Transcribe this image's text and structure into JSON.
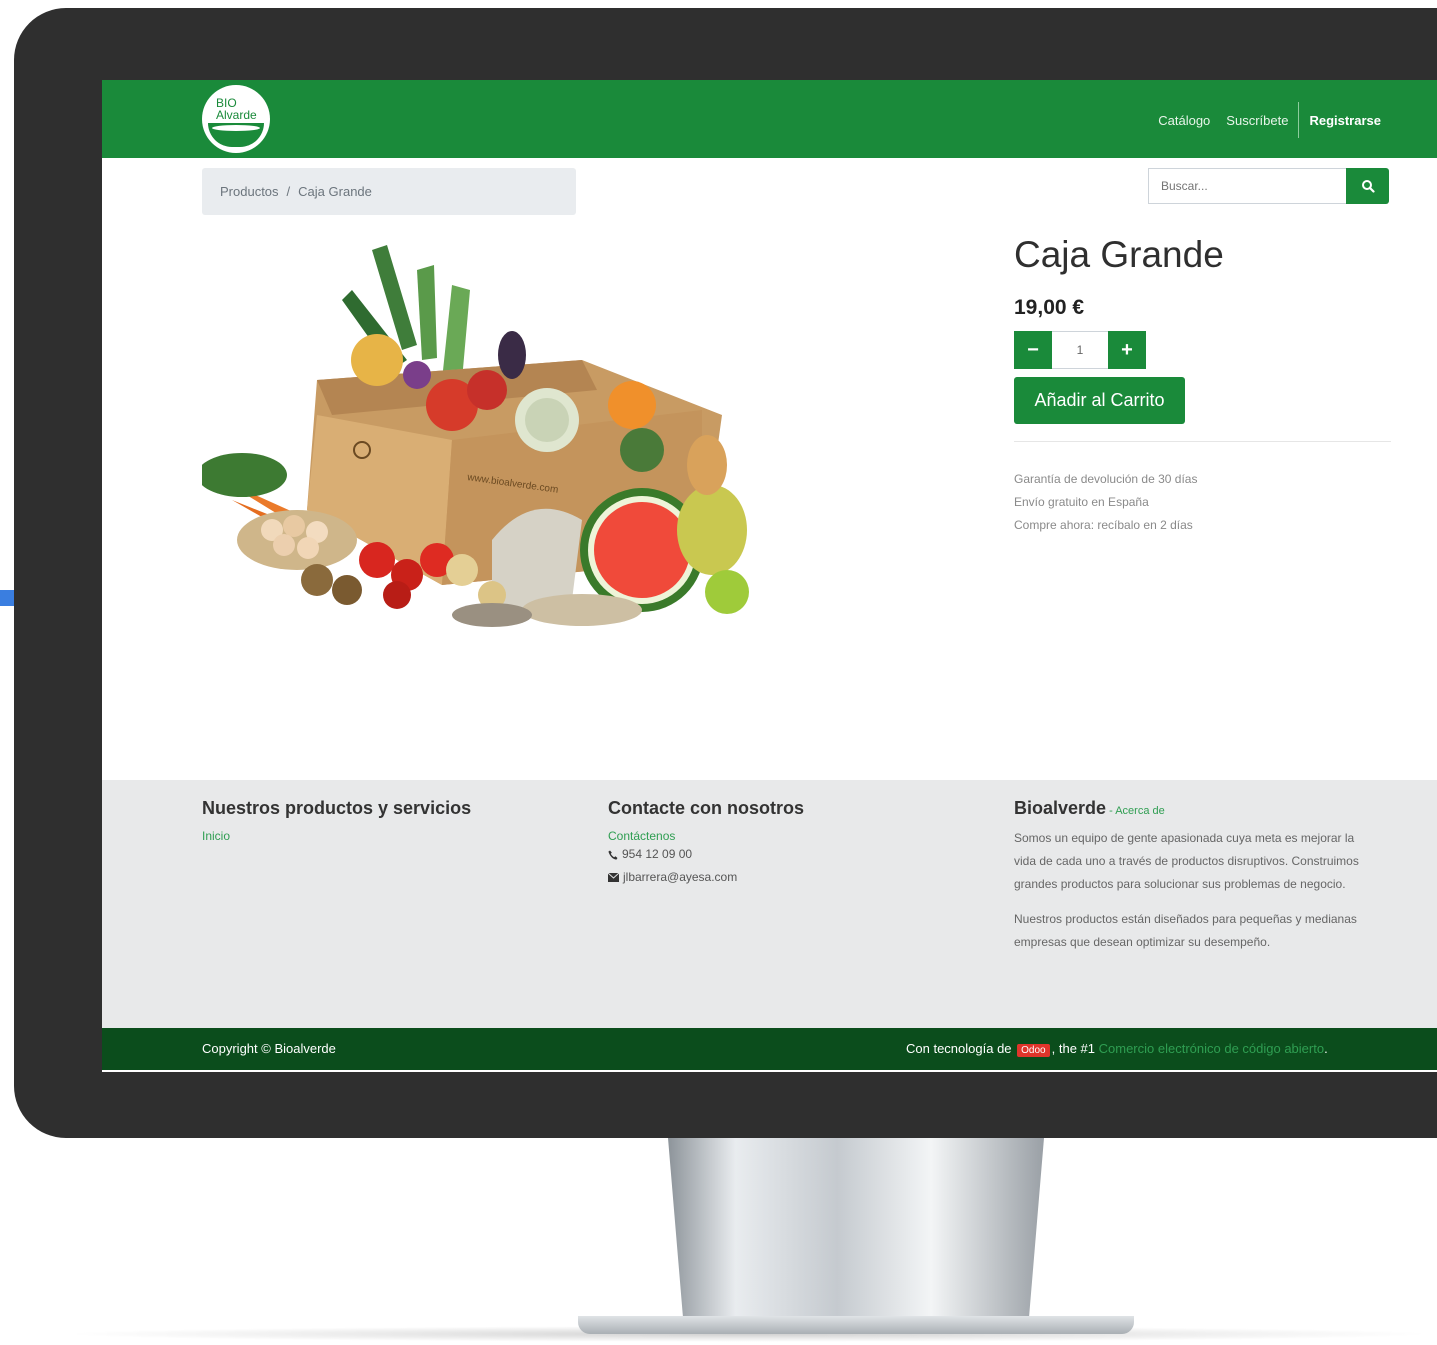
{
  "brand": {
    "logo_text": "BIO\nAlvarde",
    "primary_color": "#1a8a3a",
    "dark_color": "#0b4d1c",
    "link_color": "#2f9e52"
  },
  "nav": {
    "items": [
      {
        "label": "Catálogo"
      },
      {
        "label": "Suscríbete"
      }
    ],
    "register_label": "Registrarse"
  },
  "breadcrumb": {
    "parent": "Productos",
    "separator": "/",
    "current": "Caja Grande"
  },
  "search": {
    "placeholder": "Buscar...",
    "icon": "search-icon"
  },
  "product": {
    "title": "Caja Grande",
    "price": "19,00 €",
    "quantity": "1",
    "minus_label": "−",
    "plus_label": "+",
    "add_to_cart_label": "Añadir al Carrito",
    "info": [
      "Garantía de devolución de 30 días",
      "Envío gratuito en España",
      "Compre ahora: recíbalo en 2 días"
    ]
  },
  "footer": {
    "col1": {
      "heading": "Nuestros productos y servicios",
      "link": "Inicio"
    },
    "col2": {
      "heading": "Contacte con nosotros",
      "link": "Contáctenos",
      "phone": "954 12 09 00",
      "email": "jlbarrera@ayesa.com"
    },
    "col3": {
      "heading": "Bioalverde",
      "heading_sep": " - ",
      "about_link": "Acerca de",
      "paragraph1": "Somos un equipo de gente apasionada cuya meta es mejorar la vida de cada uno a través de productos disruptivos. Construimos grandes productos para solucionar sus problemas de negocio.",
      "paragraph2": "Nuestros productos están diseñados para pequeñas y medianas empresas que desean optimizar su desempeño."
    }
  },
  "copyright": {
    "left": "Copyright © Bioalverde",
    "powered_prefix": "Con tecnología de",
    "odoo": "Odoo",
    "powered_mid": ", the #1",
    "powered_link": "Comercio electrónico de código abierto",
    "powered_end": "."
  }
}
